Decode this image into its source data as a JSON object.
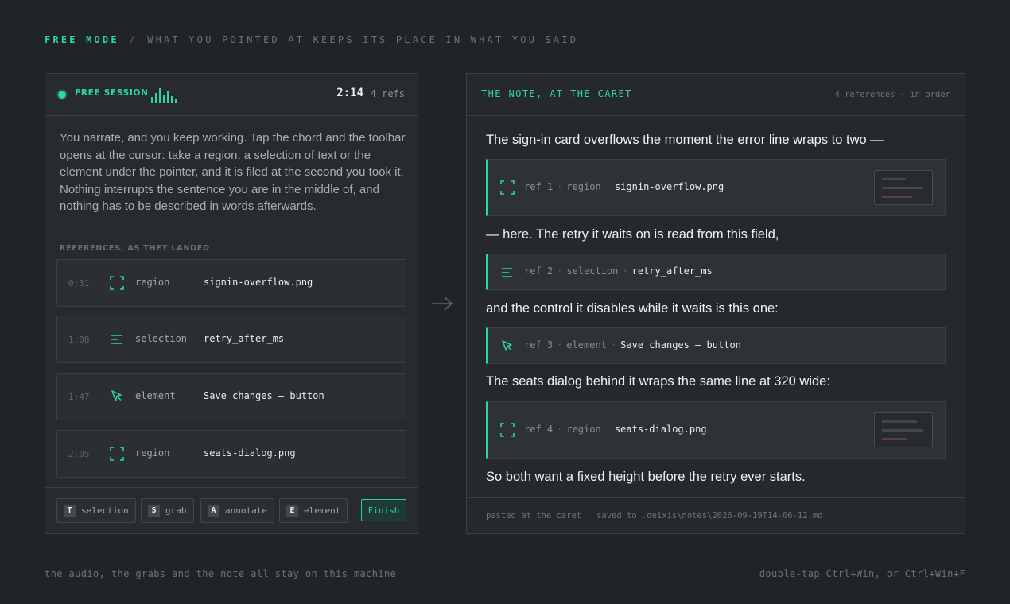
{
  "header": {
    "mode": "FREE MODE",
    "separator": "/",
    "tagline": "WHAT YOU POINTED AT KEEPS ITS PLACE IN WHAT YOU SAID"
  },
  "session": {
    "label": "FREE SESSION",
    "timer": "2:14",
    "refs_count": "4 refs",
    "description": "You narrate, and you keep working. Tap the chord and the toolbar opens at the cursor: take a region, a selection of text or the element under the pointer, and it is filed at the second you took it. Nothing interrupts the sentence you are in the middle of, and nothing has to be described in words afterwards.",
    "list_heading": "REFERENCES, AS THEY LANDED",
    "references": [
      {
        "time": "0:31",
        "icon": "region-icon",
        "kind": "region",
        "name": "signin-overflow.png"
      },
      {
        "time": "1:08",
        "icon": "selection-icon",
        "kind": "selection",
        "name": "retry_after_ms"
      },
      {
        "time": "1:47",
        "icon": "pointer-icon",
        "kind": "element",
        "name": "Save changes — button"
      },
      {
        "time": "2:05",
        "icon": "region-icon",
        "kind": "region",
        "name": "seats-dialog.png"
      }
    ]
  },
  "toolbar": {
    "buttons": [
      {
        "key": "T",
        "label": "selection"
      },
      {
        "key": "S",
        "label": "grab"
      },
      {
        "key": "A",
        "label": "annotate"
      },
      {
        "key": "E",
        "label": "element"
      }
    ],
    "finish_label": "Finish"
  },
  "note": {
    "title": "THE NOTE, AT THE CARET",
    "meta": "4 references · in order",
    "paragraphs": [
      "The sign-in card overflows the moment the error line wraps to two —",
      "— here. The retry it waits on is read from this field,",
      "and the control it disables while it waits is this one:",
      "The seats dialog behind it wraps the same line at 320 wide:",
      "So both want a fixed height before the retry ever starts."
    ],
    "refs": [
      {
        "label": "ref 1",
        "kind": "region",
        "name": "signin-overflow.png",
        "icon": "region-icon"
      },
      {
        "label": "ref 2",
        "kind": "selection",
        "name": "retry_after_ms",
        "icon": "selection-icon"
      },
      {
        "label": "ref 3",
        "kind": "element",
        "name": "Save changes — button",
        "icon": "pointer-icon"
      },
      {
        "label": "ref 4",
        "kind": "region",
        "name": "seats-dialog.png",
        "icon": "region-icon"
      }
    ],
    "separator": "·",
    "footer": "pasted at the caret · saved to .deixis\\notes\\2026-09-19T14-06-12.md"
  },
  "footer": {
    "left": "the audio, the grabs and the note all stay on this machine",
    "right": "double-tap Ctrl+Win, or Ctrl+Win+F"
  },
  "colors": {
    "accent": "#2ad6a1",
    "background": "#212427",
    "panel": "#272b2f"
  }
}
